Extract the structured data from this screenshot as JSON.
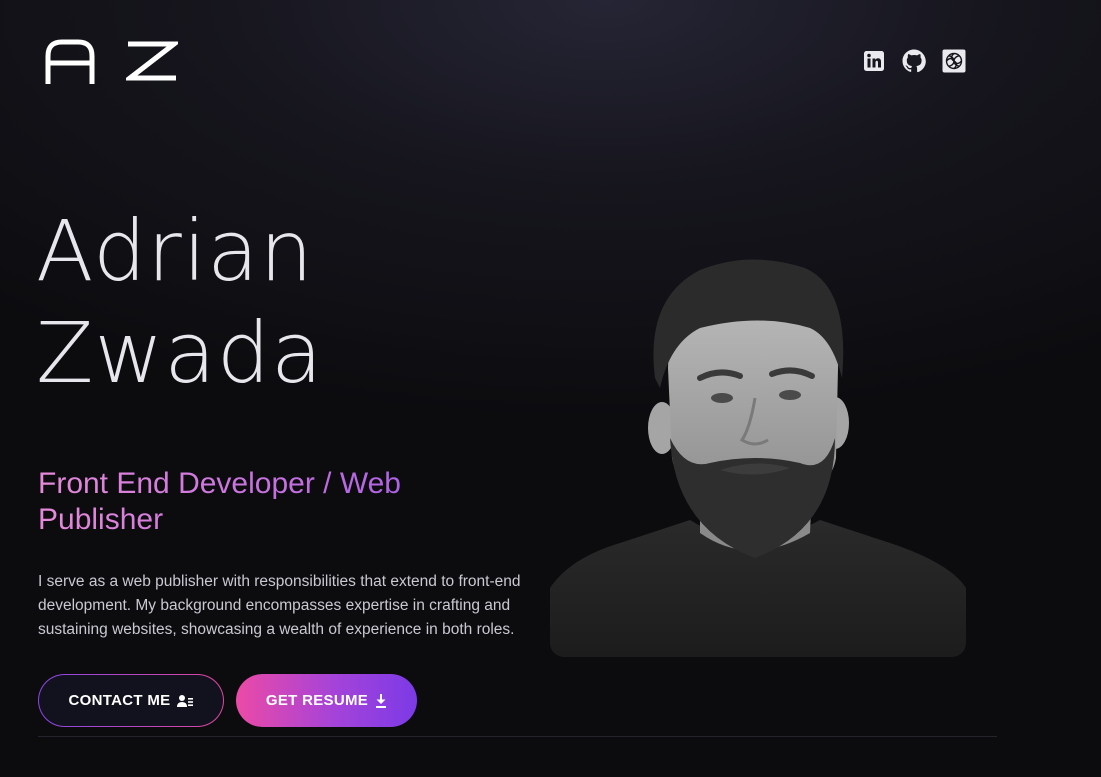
{
  "brand": {
    "initials": "A Z",
    "logo_icon": "az-monogram"
  },
  "social": {
    "links": [
      {
        "name": "linkedin",
        "icon": "linkedin-icon"
      },
      {
        "name": "github",
        "icon": "github-icon"
      },
      {
        "name": "codesandbox",
        "icon": "codesandbox-icon"
      }
    ]
  },
  "hero": {
    "first_name": "Adrian",
    "last_name": "Zwada",
    "role": "Front End Developer / Web Publisher",
    "description": "I serve as a web publisher with responsibilities that extend to front-end development. My background encompasses expertise in crafting and sustaining websites, showcasing a wealth of experience in both roles.",
    "contact_label": "CONTACT ME",
    "contact_icon": "user-list-icon",
    "resume_label": "GET RESUME",
    "resume_icon": "download-icon"
  },
  "colors": {
    "accent_pink": "#ec4aa6",
    "accent_purple": "#7c3ae6",
    "background": "#0c0c0f"
  }
}
